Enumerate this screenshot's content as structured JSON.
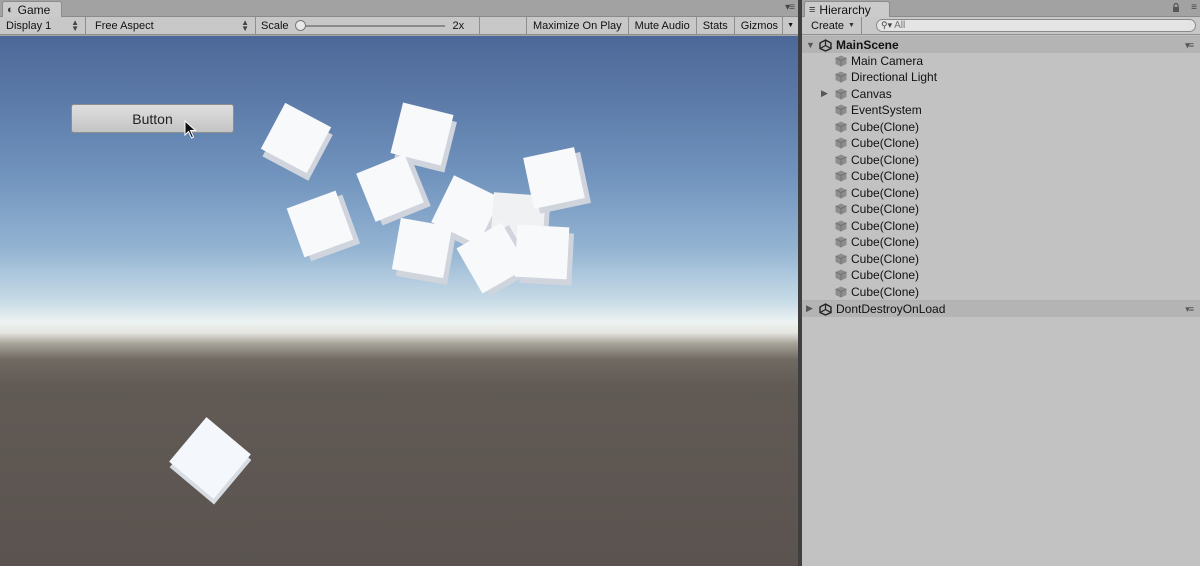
{
  "game": {
    "tab_label": "Game",
    "toolbar": {
      "display": "Display 1",
      "aspect": "Free Aspect",
      "scale_label": "Scale",
      "scale_value": "2x",
      "maximize": "Maximize On Play",
      "mute": "Mute Audio",
      "stats": "Stats",
      "gizmos": "Gizmos"
    },
    "button_label": "Button"
  },
  "hierarchy": {
    "tab_label": "Hierarchy",
    "create_label": "Create",
    "search_placeholder": "All",
    "scenes": [
      {
        "name": "MainScene",
        "expanded": true,
        "items": [
          "Main Camera",
          "Directional Light",
          "Canvas",
          "EventSystem",
          "Cube(Clone)",
          "Cube(Clone)",
          "Cube(Clone)",
          "Cube(Clone)",
          "Cube(Clone)",
          "Cube(Clone)",
          "Cube(Clone)",
          "Cube(Clone)",
          "Cube(Clone)",
          "Cube(Clone)",
          "Cube(Clone)"
        ]
      },
      {
        "name": "DontDestroyOnLoad",
        "expanded": false
      }
    ]
  },
  "colors": {
    "panel_bg": "#c2c2c2",
    "toolbar_bg": "#c8c8c8",
    "sky_top": "#4c6898",
    "horizon": "#edf3f2",
    "ground": "#5a534f",
    "cube": "#f8f9fb"
  },
  "icons": [
    "game-controller-icon",
    "hierarchy-list-icon",
    "lock-icon",
    "panel-menu-icon",
    "unity-scene-icon",
    "gameobject-cube-icon",
    "foldout-arrow-icon",
    "search-icon",
    "mouse-cursor-icon"
  ]
}
